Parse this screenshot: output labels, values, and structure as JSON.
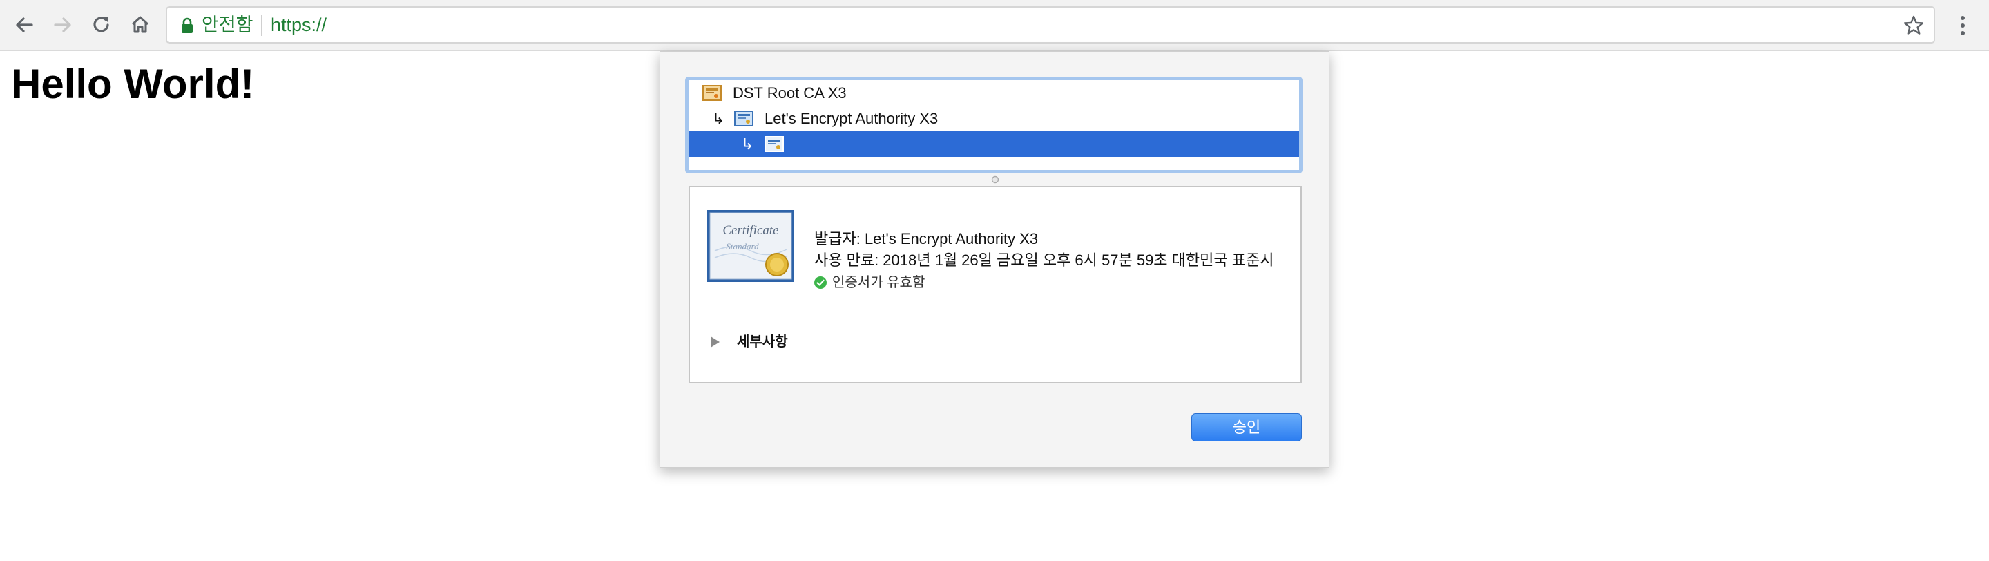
{
  "browser": {
    "security_label": "안전함",
    "url": "https://",
    "icons": {
      "back": "back-arrow-icon",
      "forward": "forward-arrow-icon",
      "reload": "reload-icon",
      "home": "home-icon",
      "lock": "lock-icon",
      "bookmark": "star-icon",
      "menu": "more-vert-icon"
    },
    "secure_color": "#1e7e34"
  },
  "page": {
    "heading": "Hello World!"
  },
  "certificate_dialog": {
    "chain": [
      {
        "label": "DST Root CA X3",
        "selected": false
      },
      {
        "label": "Let's Encrypt Authority X3",
        "selected": false
      },
      {
        "label": "",
        "selected": true
      }
    ],
    "selection_color": "#2c6bd6",
    "issuer_line": "발급자: Let's Encrypt Authority X3",
    "expiry_line": "사용 만료: 2018년 1월 26일 금요일 오후 6시 57분 59초 대한민국 표준시",
    "validity_text": "인증서가 유효함",
    "validity_color": "#3cb54a",
    "details_label": "세부사항",
    "ok_label": "승인",
    "certificate_image_text": [
      "Certificate",
      "Standard"
    ]
  }
}
